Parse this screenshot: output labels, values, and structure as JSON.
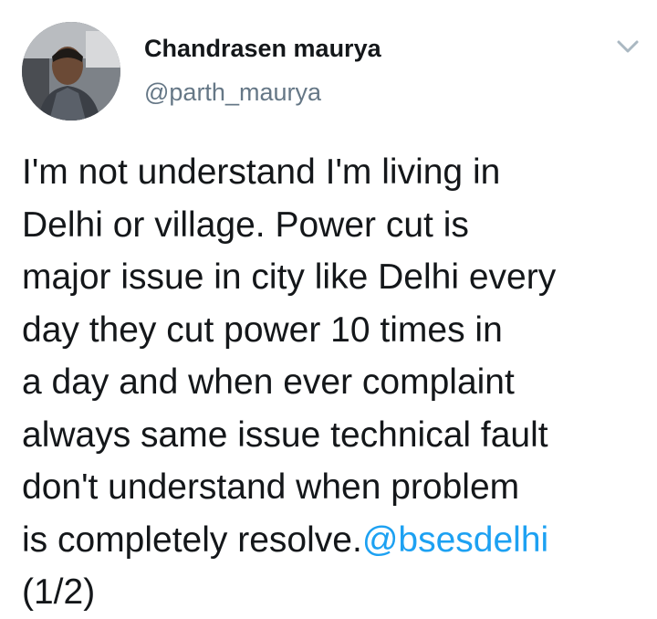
{
  "tweet": {
    "author": {
      "name": "Chandrasen maurya",
      "handle": "@parth_maurya",
      "avatar_icon": "profile-photo"
    },
    "menu_icon": "chevron-down-icon",
    "text": {
      "line1": "I'm not understand I'm living in",
      "line2": "Delhi or village. Power cut is",
      "line3": "major issue in city like Delhi every",
      "line4": "day they cut power 10 times in",
      "line5": "a day and when ever complaint",
      "line6": "always same issue technical fault",
      "line7": "don't understand when problem",
      "line8_prefix": "is completely resolve.",
      "mention": "@bsesdelhi",
      "thread_count": "(1/2)"
    },
    "colors": {
      "text": "#14171a",
      "secondary": "#657786",
      "link": "#1da1f2",
      "chevron": "#aab8c2"
    }
  }
}
